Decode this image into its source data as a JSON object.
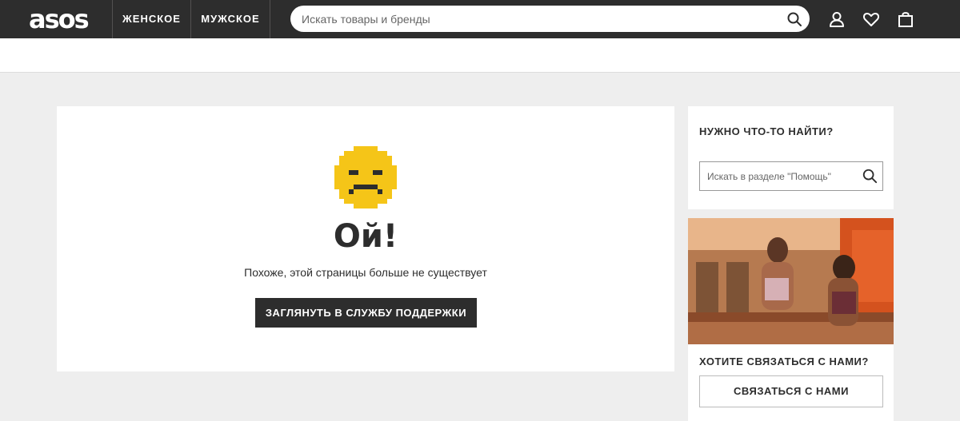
{
  "header": {
    "logo": "asos",
    "nav": [
      {
        "label": "ЖЕНСКОЕ"
      },
      {
        "label": "МУЖСКОЕ"
      }
    ],
    "search": {
      "placeholder": "Искать товары и бренды",
      "value": ""
    },
    "icons": [
      "search-icon",
      "account-icon",
      "heart-icon",
      "bag-icon"
    ]
  },
  "error": {
    "icon": "sad-face-icon",
    "title": "Ой!",
    "message": "Похоже, этой страницы больше не существует",
    "button_label": "ЗАГЛЯНУТЬ В СЛУЖБУ ПОДДЕРЖКИ"
  },
  "help": {
    "title": "НУЖНО ЧТО-ТО НАЙТИ?",
    "search": {
      "placeholder": "Искать в разделе \"Помощь\"",
      "value": ""
    }
  },
  "contact": {
    "title": "ХОТИТЕ СВЯЗАТЬСЯ С НАМИ?",
    "button_label": "СВЯЗАТЬСЯ С НАМИ"
  },
  "colors": {
    "header_bg": "#2d2d2d",
    "page_bg": "#eeeeee",
    "face_yellow": "#f5c518",
    "text": "#2d2d2d"
  }
}
